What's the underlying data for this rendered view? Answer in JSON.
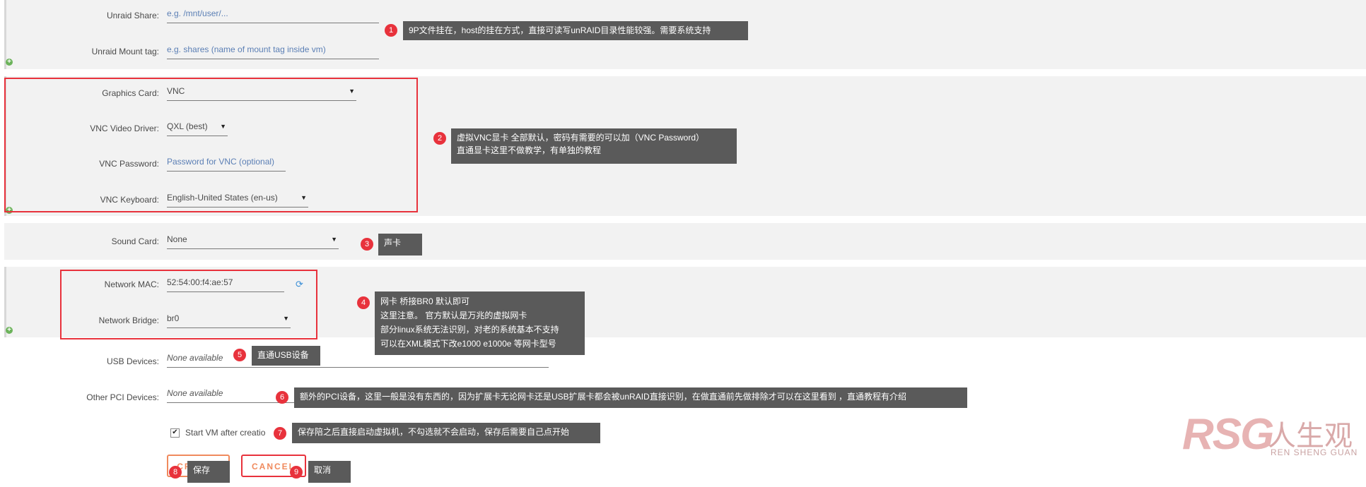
{
  "share": {
    "unraid_share_label": "Unraid Share:",
    "unraid_share_placeholder": "e.g. /mnt/user/...",
    "mount_tag_label": "Unraid Mount tag:",
    "mount_tag_placeholder": "e.g. shares (name of mount tag inside vm)"
  },
  "graphics": {
    "card_label": "Graphics Card:",
    "card_value": "VNC",
    "driver_label": "VNC Video Driver:",
    "driver_value": "QXL (best)",
    "password_label": "VNC Password:",
    "password_placeholder": "Password for VNC (optional)",
    "keyboard_label": "VNC Keyboard:",
    "keyboard_value": "English-United States (en-us)"
  },
  "sound": {
    "label": "Sound Card:",
    "value": "None"
  },
  "network": {
    "mac_label": "Network MAC:",
    "mac_value": "52:54:00:f4:ae:57",
    "bridge_label": "Network Bridge:",
    "bridge_value": "br0"
  },
  "usb": {
    "label": "USB Devices:",
    "value": "None available"
  },
  "pci": {
    "label": "Other PCI Devices:",
    "value": "None available"
  },
  "start_vm": {
    "label": "Start VM after creatio",
    "checked": true
  },
  "buttons": {
    "create": "CREATE",
    "cancel": "CANCEL"
  },
  "annotations": [
    {
      "num": "1",
      "text": "9P文件挂在，host的挂在方式，直接可读写unRAID目录性能较强。需要系统支持"
    },
    {
      "num": "2",
      "line1": "虚拟VNC显卡 全部默认，密码有需要的可以加（VNC Password）",
      "line2": "直通显卡这里不做教学，有单独的教程"
    },
    {
      "num": "3",
      "text": "声卡"
    },
    {
      "num": "4",
      "line1": "网卡 桥接BR0 默认即可",
      "line2": "这里注意。 官方默认是万兆的虚拟网卡",
      "line3": "部分linux系统无法识别，对老的系统基本不支持",
      "line4": "可以在XML模式下改e1000 e1000e 等网卡型号"
    },
    {
      "num": "5",
      "text": "直通USB设备"
    },
    {
      "num": "6",
      "text": "额外的PCI设备，这里一般是没有东西的，因为扩展卡无论网卡还是USB扩展卡都会被unRAID直接识别，在做直通前先做排除才可以在这里看到 ，直通教程有介绍"
    },
    {
      "num": "7",
      "text": "保存陪之后直接启动虚拟机，不勾选就不会启动，保存后需要自己点开始"
    },
    {
      "num": "8",
      "text": "保存"
    },
    {
      "num": "9",
      "text": "取消"
    }
  ],
  "watermark": {
    "logo": "RSG",
    "cn": "人生观",
    "en": "REN SHENG GUAN"
  },
  "colors": {
    "accent_red": "#e8323c",
    "button_orange": "#f08a5d",
    "placeholder_blue": "#5b7fb5",
    "plus_green": "#6cb35b"
  }
}
